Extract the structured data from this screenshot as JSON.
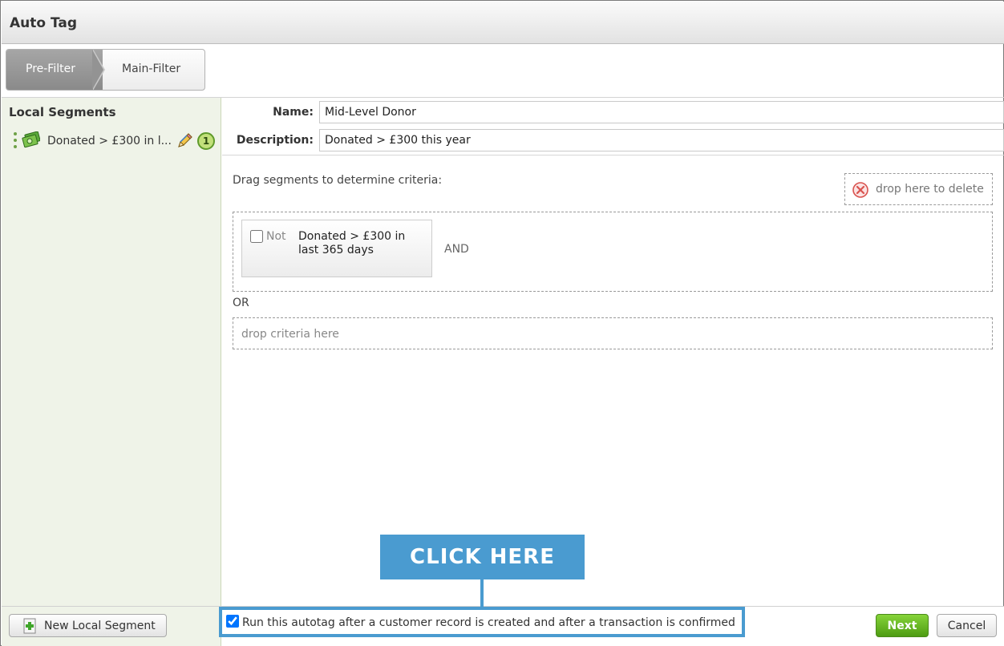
{
  "window": {
    "title": "Auto Tag"
  },
  "steps": [
    {
      "label": "Pre-Filter",
      "active": true
    },
    {
      "label": "Main-Filter",
      "active": false
    }
  ],
  "sidebar": {
    "title": "Local Segments",
    "items": [
      {
        "label": "Donated > £300 in l...",
        "count": "1"
      }
    ]
  },
  "form": {
    "name_label": "Name:",
    "name_value": "Mid-Level Donor",
    "description_label": "Description:",
    "description_value": "Donated > £300 this year"
  },
  "criteria": {
    "hint": "Drag segments to determine criteria:",
    "delete_zone": "drop here to delete",
    "groups": [
      {
        "items": [
          {
            "not_label": "Not",
            "not_checked": false,
            "text": "Donated > £300 in last 365 days"
          }
        ],
        "joiner": "AND"
      }
    ],
    "or_label": "OR",
    "drop_placeholder": "drop criteria here"
  },
  "footer": {
    "new_segment_label": "New Local Segment",
    "autorun_label": "Run this autotag after a customer record is created and after a transaction is confirmed",
    "autorun_checked": true,
    "next_label": "Next",
    "cancel_label": "Cancel"
  },
  "callout": {
    "text": "CLICK HERE"
  },
  "colors": {
    "callout": "#4a9bd0",
    "sidebar_bg": "#eff3e8",
    "next_button": "#5aaa1a",
    "delete_icon": "#d9534f"
  },
  "icons": {
    "segment": "money-icon",
    "edit": "pencil-icon",
    "delete": "close-circle-icon",
    "new": "plus-document-icon"
  }
}
